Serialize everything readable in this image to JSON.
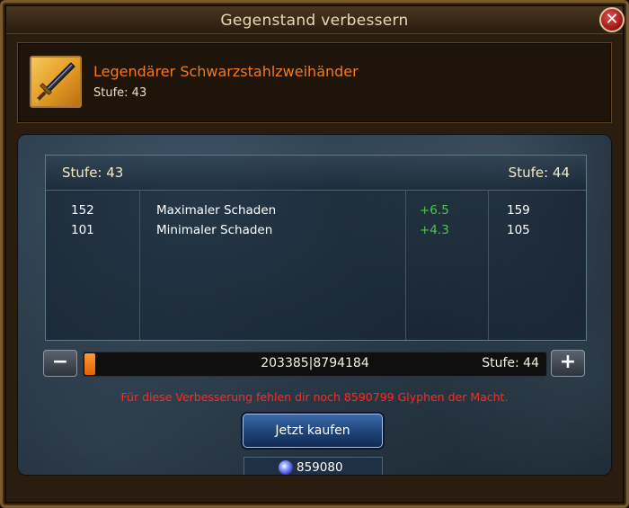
{
  "window": {
    "title": "Gegenstand verbessern",
    "close_label": "✕"
  },
  "item": {
    "name": "Legendärer Schwarzstahlzweihänder",
    "level_text": "Stufe: 43",
    "icon": "two-handed-sword-icon"
  },
  "comparison": {
    "current_level": "Stufe: 43",
    "next_level": "Stufe: 44",
    "rows": [
      {
        "current": "152",
        "stat": "Maximaler Schaden",
        "delta": "+6.5",
        "next": "159"
      },
      {
        "current": "101",
        "stat": "Minimaler Schaden",
        "delta": "+4.3",
        "next": "105"
      }
    ]
  },
  "upgrade": {
    "minus_label": "−",
    "plus_label": "+",
    "progress_text": "203385|8794184",
    "progress_fraction": 0.023,
    "target_level": "Stufe: 44",
    "warning": "Für diese Verbesserung fehlen dir noch 8590799 Glyphen der Macht.",
    "buy_label": "Jetzt kaufen",
    "glyph_count": "859080",
    "glyph_icon": "glyph-orb-icon"
  },
  "colors": {
    "item_name": "#f07a1e",
    "delta": "#4ec54a",
    "warning": "#ff2a1e",
    "progress": "#ff8a1c"
  }
}
